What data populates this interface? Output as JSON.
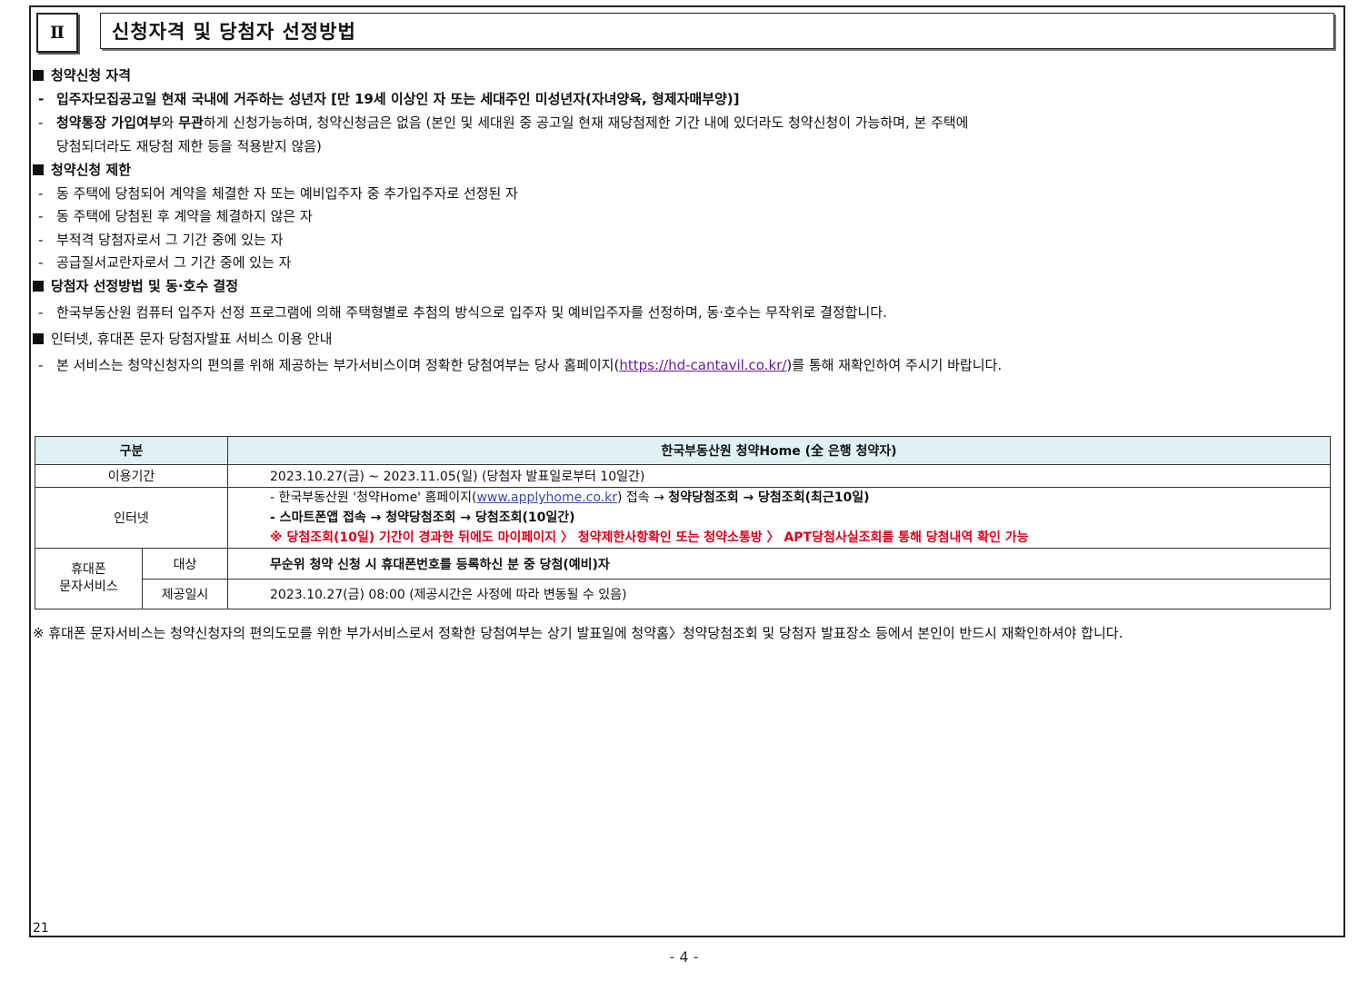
{
  "header": {
    "roman": "Ⅱ",
    "title": "신청자격 및 당첨자 선정방법"
  },
  "sections": {
    "eligibility": {
      "title": "청약신청 자격",
      "line1": "입주자모집공고일 현재 국내에 거주하는 성년자 [만 19세 이상인 자 또는 세대주인 미성년자(자녀양육, 형제자매부양)]",
      "line2_b1": "청약통장 가입여부",
      "line2_t1": "와 ",
      "line2_b2": "무관",
      "line2_t2": "하게 신청가능하며, 청약신청금은 없음 (본인 및 세대원 중 공고일 현재 재당첨제한 기간 내에 있더라도 청약신청이 가능하며, 본 주택에",
      "line3": "당첨되더라도 재당첨 제한 등을 적용받지 않음)"
    },
    "restriction": {
      "title": "청약신청 제한",
      "items": [
        "동 주택에 당첨되어 계약을 체결한 자 또는 예비입주자 중 추가입주자로 선정된 자",
        "동 주택에 당첨된 후 계약을 체결하지 않은 자",
        "부적격 당첨자로서 그 기간 중에 있는 자",
        "공급질서교란자로서 그 기간 중에 있는 자"
      ]
    },
    "selection": {
      "title": "당첨자 선정방법 및 동·호수 결정",
      "line1": "한국부동산원 컴퓨터 입주자 선정 프로그램에 의해 주택형별로 추첨의 방식으로 입주자 및 예비입주자를 선정하며, 동·호수는 무작위로 결정합니다."
    },
    "service": {
      "title": "인터넷, 휴대폰 문자 당첨자발표 서비스 이용 안내",
      "line1_pre": "본 서비스는 청약신청자의 편의를 위해 제공하는 부가서비스이며 정확한 당첨여부는 당사 홈페이지(",
      "line1_link": "https://hd-cantavil.co.kr/",
      "line1_post": ")를 통해 재확인하여 주시기 바랍니다."
    }
  },
  "table": {
    "col1_header": "구분",
    "col2_header": "한국부동산원 청약Home (全 은행 청약자)",
    "period_label": "이용기간",
    "period_value": "2023.10.27(금) ~ 2023.11.05(일) (당첨자 발표일로부터 10일간)",
    "internet_label": "인터넷",
    "internet_l1_pre": "- 한국부동산원 '청약Home' 홈페이지(",
    "internet_l1_link": "www.applyhome.co.kr",
    "internet_l1_mid": ") 접속 → ",
    "internet_l1_bold": "청약당첨조회 → 당첨조회(최근10일)",
    "internet_l2": "- 스마트폰앱 접속  → 청약당첨조회 → 당첨조회(10일간)",
    "internet_l3": "※ 당첨조회(10일) 기간이 경과한 뒤에도 마이페이지 〉 청약제한사항확인 또는 청약소통방 〉 APT당첨사실조회를 통해 당첨내역 확인 가능",
    "mobile_label": "휴대폰\n문자서비스",
    "target_label": "대상",
    "target_value": "무순위 청약 신청 시 휴대폰번호를 등록하신 분 중 당첨(예비)자",
    "provide_label": "제공일시",
    "provide_value": "2023.10.27(금) 08:00 (제공시간은 사정에 따라 변동될 수 있음)"
  },
  "footnote": "※ 휴대폰 문자서비스는 청약신청자의 편의도모를 위한 부가서비스로서 정확한 당첨여부는 상기 발표일에 청약홈〉청약당첨조회 및 당첨자 발표장소 등에서 본인이 반드시 재확인하셔야 합니다.",
  "page_code": "21",
  "page_number": "- 4 -",
  "colors": {
    "table_header_bg": "#dff1f5",
    "red_note": "#e0001b",
    "link": "#6a1b9a"
  }
}
